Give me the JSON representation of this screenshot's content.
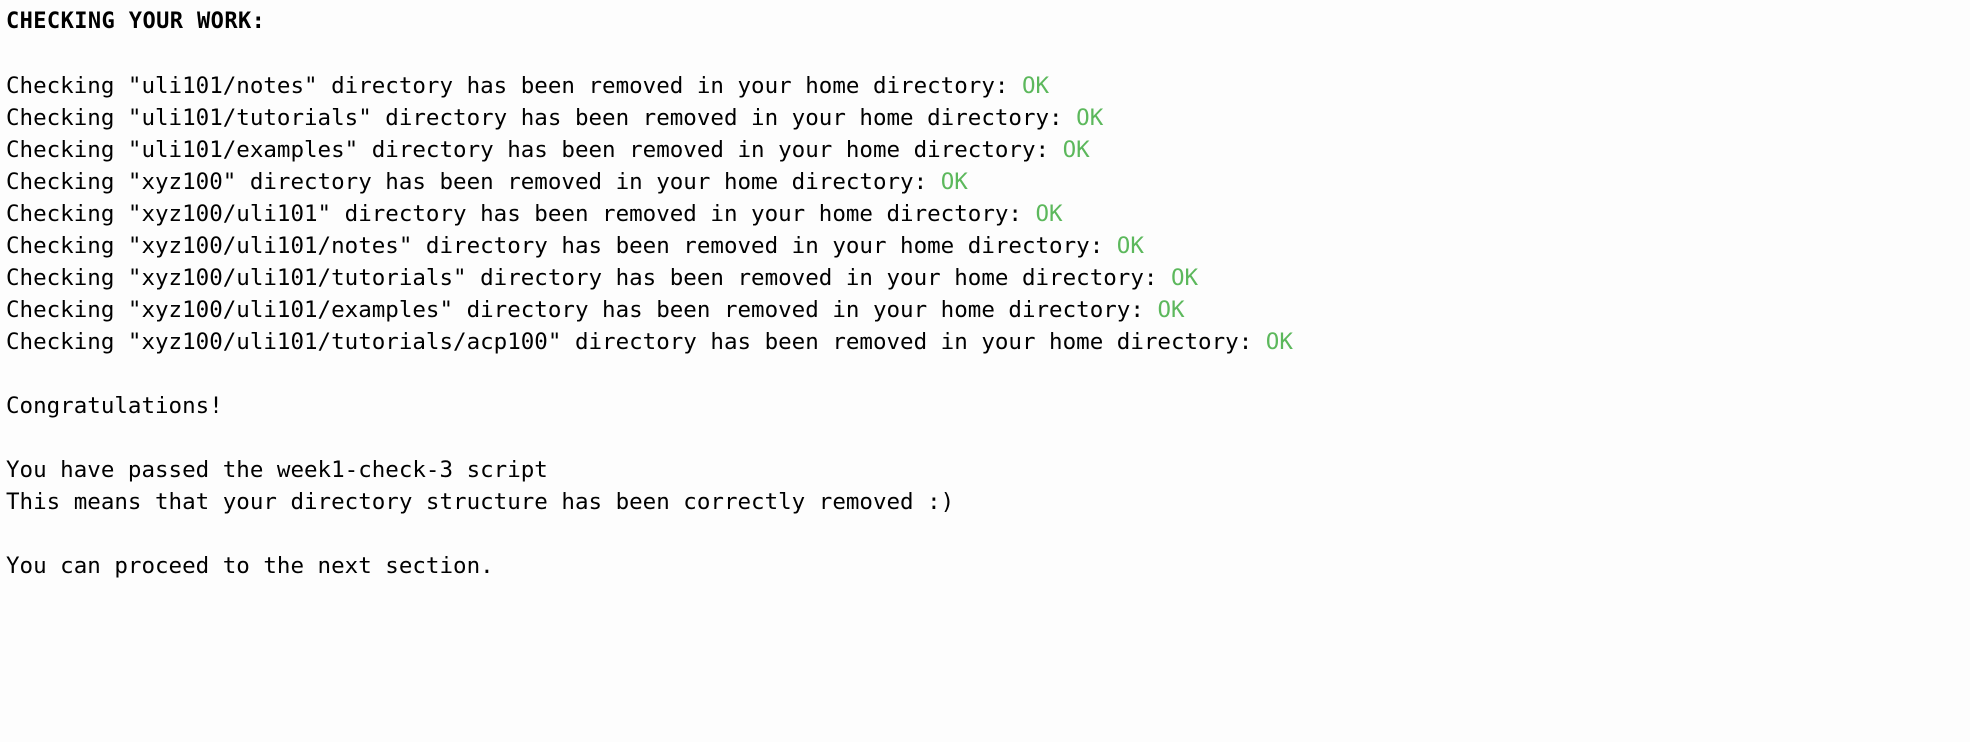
{
  "terminal": {
    "heading": "CHECKING YOUR WORK:",
    "colors": {
      "background": "#fdfdfd",
      "text": "#000000",
      "status_ok": "#5cb85c"
    },
    "check_lines": [
      {
        "prefix": "Checking \"uli101/notes\" directory has been removed in your home directory: ",
        "status": "OK"
      },
      {
        "prefix": "Checking \"uli101/tutorials\" directory has been removed in your home directory: ",
        "status": "OK"
      },
      {
        "prefix": "Checking \"uli101/examples\" directory has been removed in your home directory: ",
        "status": "OK"
      },
      {
        "prefix": "Checking \"xyz100\" directory has been removed in your home directory: ",
        "status": "OK"
      },
      {
        "prefix": "Checking \"xyz100/uli101\" directory has been removed in your home directory: ",
        "status": "OK"
      },
      {
        "prefix": "Checking \"xyz100/uli101/notes\" directory has been removed in your home directory: ",
        "status": "OK"
      },
      {
        "prefix": "Checking \"xyz100/uli101/tutorials\" directory has been removed in your home directory: ",
        "status": "OK"
      },
      {
        "prefix": "Checking \"xyz100/uli101/examples\" directory has been removed in your home directory: ",
        "status": "OK"
      },
      {
        "prefix": "Checking \"xyz100/uli101/tutorials/acp100\" directory has been removed in your home directory: ",
        "status": "OK"
      }
    ],
    "congratulations": "Congratulations!",
    "result_lines": [
      "You have passed the week1-check-3 script",
      "This means that your directory structure has been correctly removed :)"
    ],
    "next_step": "You can proceed to the next section."
  }
}
